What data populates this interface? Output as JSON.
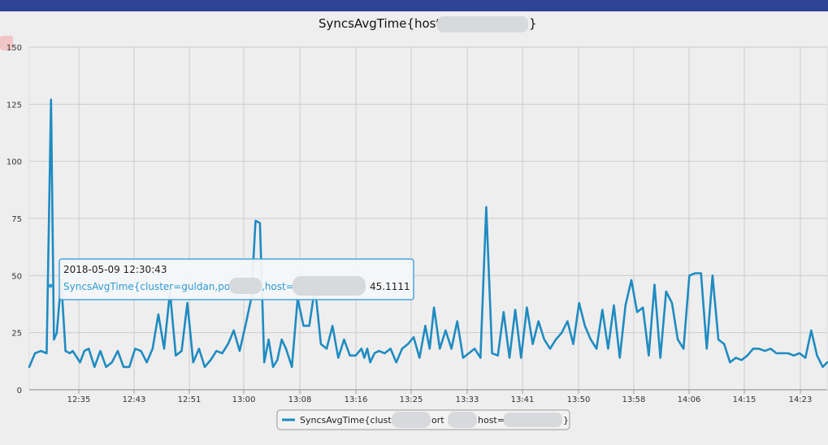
{
  "colors": {
    "topbar": "#2d4594",
    "background": "#eeeeee",
    "grid": "#cccccc",
    "series": "#1f8bc1",
    "tooltip_border": "#4aa3d9",
    "tooltip_series_text": "#2b9bd6"
  },
  "tooltip": {
    "timestamp": "2018-05-09 12:30:43",
    "series_label_prefix": "SyncsAvgTime{cluster=guldan,port=",
    "series_label_mid": ",host=",
    "value": "45.1111"
  },
  "legend": {
    "label_part1": "SyncsAvgTime{cluster=",
    "label_part2": "ort",
    "label_part3": "host=",
    "label_part4": "}"
  },
  "chart_data": {
    "type": "line",
    "title_prefix": "SyncsAvgTime{host=",
    "title_suffix": "}",
    "xlabel": "",
    "ylabel": "",
    "ylim": [
      0,
      150
    ],
    "yticks": [
      0,
      25,
      50,
      75,
      100,
      125,
      150
    ],
    "x_tick_labels": [
      "12:35",
      "12:43",
      "12:51",
      "13:00",
      "13:08",
      "13:16",
      "13:25",
      "13:33",
      "13:41",
      "13:50",
      "13:58",
      "14:06",
      "14:15",
      "14:23"
    ],
    "xlim_minutes": [
      720,
      775
    ],
    "grid": true,
    "legend_placement": "bottom-center",
    "series": [
      {
        "x_minutes": [
          720.0,
          720.4,
          720.8,
          721.2,
          721.5,
          721.7,
          721.9,
          722.2,
          722.5,
          722.8,
          723.0,
          723.2,
          723.5,
          723.8,
          724.1,
          724.5,
          724.9,
          725.3,
          725.7,
          726.1,
          726.5,
          726.9,
          727.3,
          727.7,
          728.1,
          728.5,
          728.9,
          729.3,
          729.7,
          730.1,
          730.5,
          730.9,
          731.3,
          731.7,
          732.1,
          732.5,
          732.9,
          733.3,
          733.7,
          734.1,
          734.5,
          734.9,
          735.3,
          735.6,
          735.9,
          736.2,
          736.5,
          736.8,
          737.1,
          737.4,
          737.7,
          738.1,
          738.5,
          738.9,
          739.3,
          739.7,
          740.1,
          740.5,
          740.9,
          741.3,
          741.7,
          742.1,
          742.5,
          742.9,
          743.1,
          743.3,
          743.5,
          743.8,
          744.1,
          744.5,
          744.9,
          745.3,
          745.7,
          746.1,
          746.5,
          746.9,
          747.3,
          747.6,
          747.9,
          748.3,
          748.7,
          749.1,
          749.5,
          749.9,
          750.3,
          750.7,
          751.1,
          751.5,
          751.9,
          752.3,
          752.7,
          753.1,
          753.5,
          753.9,
          754.3,
          754.7,
          755.1,
          755.5,
          755.9,
          756.3,
          756.7,
          757.1,
          757.5,
          757.9,
          758.3,
          758.7,
          759.1,
          759.5,
          759.9,
          760.3,
          760.7,
          761.1,
          761.5,
          761.9,
          762.3,
          762.7,
          763.1,
          763.5,
          763.9,
          764.3,
          764.7,
          765.1,
          765.5,
          765.9,
          766.3,
          766.7,
          767.1,
          767.5,
          767.9,
          768.3,
          768.7,
          769.1,
          769.5,
          769.9,
          770.3,
          770.7,
          771.1,
          771.5,
          771.9,
          772.3,
          772.7,
          773.1,
          773.5,
          773.9,
          774.3,
          774.7,
          775.0
        ],
        "values": [
          10,
          16,
          17,
          16,
          127,
          22,
          25,
          48,
          17,
          16,
          17,
          15,
          12,
          17,
          18,
          10,
          17,
          10,
          12,
          17,
          10,
          10,
          18,
          17,
          12,
          18,
          33,
          18,
          43,
          15,
          17,
          38,
          12,
          18,
          10,
          13,
          17,
          16,
          20,
          26,
          17,
          28,
          40,
          74,
          73,
          12,
          22,
          10,
          13,
          22,
          18,
          10,
          40,
          28,
          28,
          45,
          20,
          18,
          28,
          14,
          22,
          15,
          15,
          18,
          14,
          18,
          12,
          16,
          17,
          16,
          18,
          12,
          18,
          20,
          23,
          14,
          28,
          18,
          36,
          18,
          26,
          18,
          30,
          14,
          16,
          18,
          14,
          80,
          16,
          15,
          34,
          14,
          35,
          14,
          36,
          20,
          30,
          22,
          18,
          22,
          25,
          30,
          20,
          38,
          28,
          22,
          18,
          35,
          18,
          37,
          14,
          37,
          48,
          34,
          36,
          15,
          46,
          14,
          43,
          38,
          22,
          18,
          50,
          51,
          51,
          18,
          50,
          22,
          20,
          12,
          14,
          13,
          15,
          18,
          18,
          17,
          18,
          16,
          16,
          16,
          15,
          16,
          14,
          26,
          15,
          10,
          12,
          14,
          20,
          31,
          13,
          12
        ]
      }
    ]
  }
}
